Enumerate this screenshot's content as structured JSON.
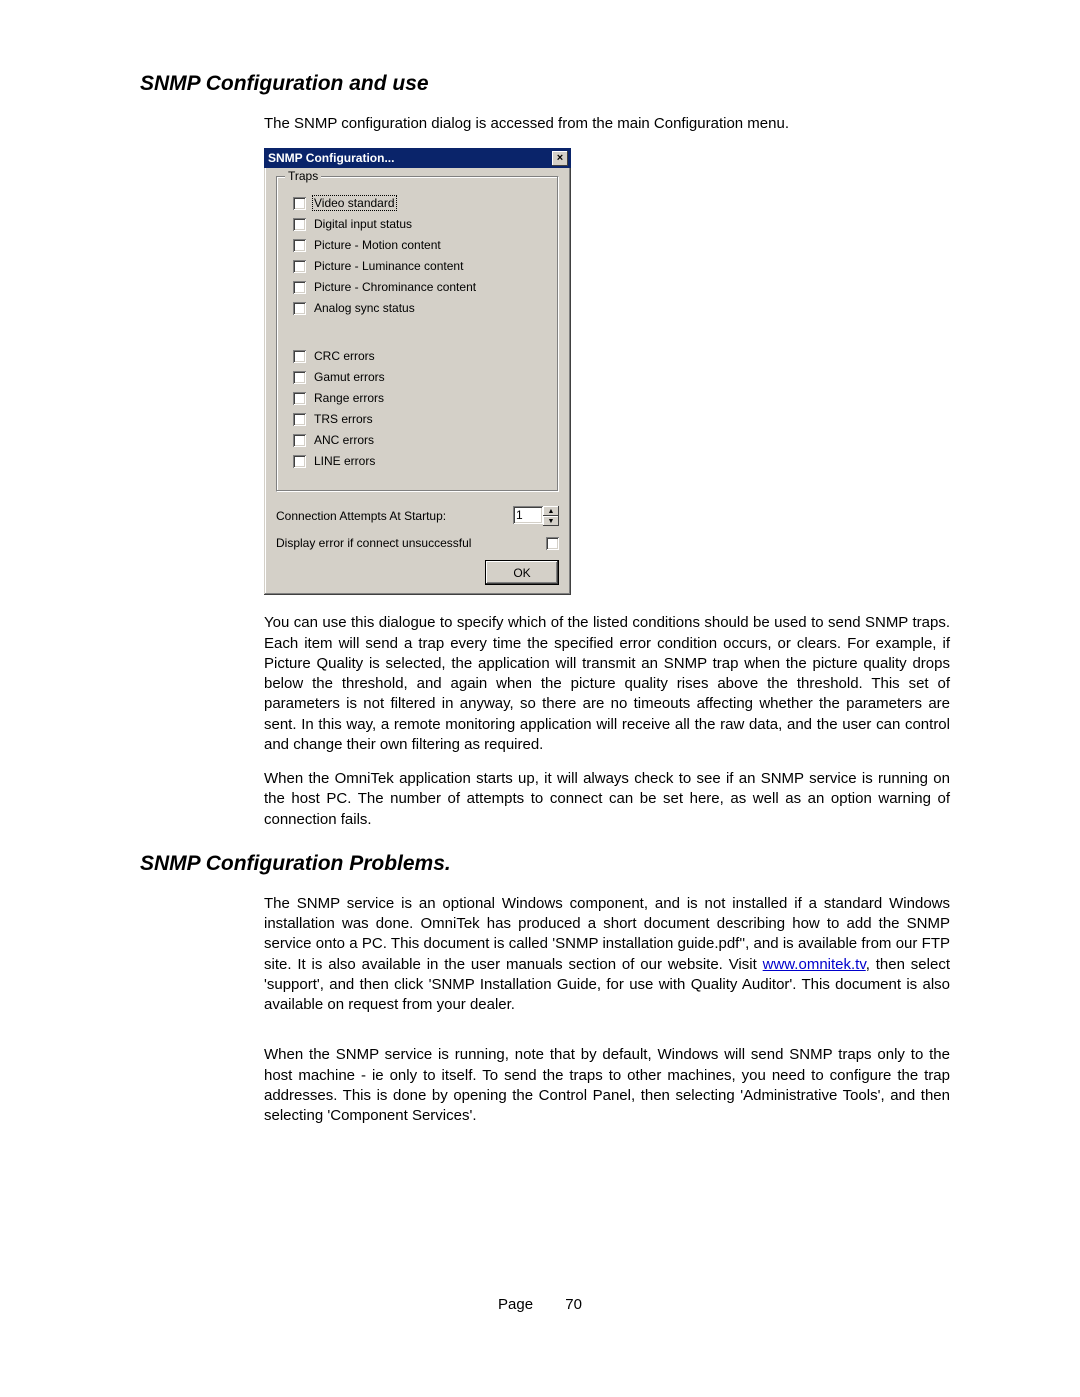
{
  "heading1": "SNMP Configuration and use",
  "intro": "The SNMP configuration dialog is accessed from the main Configuration menu.",
  "dialog": {
    "title": "SNMP Configuration...",
    "close_glyph": "×",
    "group_title": "Traps",
    "traps_a": [
      "Video standard",
      "Digital input status",
      "Picture - Motion content",
      "Picture - Luminance content",
      "Picture - Chrominance content",
      "Analog sync status"
    ],
    "traps_b": [
      "CRC errors",
      "Gamut errors",
      "Range errors",
      "TRS errors",
      "ANC errors",
      "LINE errors"
    ],
    "conn_label": "Connection Attempts At Startup:",
    "conn_value": "1",
    "err_label": "Display error if connect unsuccessful",
    "ok_label": "OK"
  },
  "para1": "You can use this dialogue to specify which of the listed conditions should be used to send SNMP traps.  Each item will send a trap every time the specified error condition occurs, or clears.  For example, if Picture Quality is selected, the application will transmit an SNMP trap when the picture quality drops below the threshold, and again when the picture quality rises above the threshold.  This set of parameters is not filtered in anyway, so there are no timeouts affecting whether the parameters are sent.  In this way, a remote monitoring application will receive all the raw data, and the user can control and change their own filtering as required.",
  "para2": "When the OmniTek application starts up, it will always check to see if an SNMP service is running on the host PC.  The number of attempts to connect can be set here, as well as an option warning of connection fails.",
  "heading2": "SNMP Configuration Problems.",
  "para3a": "The SNMP service is an optional Windows component, and is not installed if a standard Windows installation was done.  OmniTek has produced a short document describing how to add the SNMP service onto a PC.  This document is called 'SNMP installation guide.pdf'', and is available from our FTP site.  It is also available in the user manuals section of our website.  Visit ",
  "link": "www.omnitek.tv",
  "para3b": ", then select 'support', and then click 'SNMP Installation Guide, for use with Quality Auditor'.  This document is also available on request from your dealer.",
  "para4": "When the SNMP service is running, note that by default, Windows will send SNMP traps only to the host machine - ie only to itself.  To send the traps to other machines, you need to configure the trap addresses.  This is done by opening the Control Panel, then selecting 'Administrative Tools', and then selecting 'Component Services'.",
  "footer": {
    "label": "Page",
    "num": "70"
  }
}
